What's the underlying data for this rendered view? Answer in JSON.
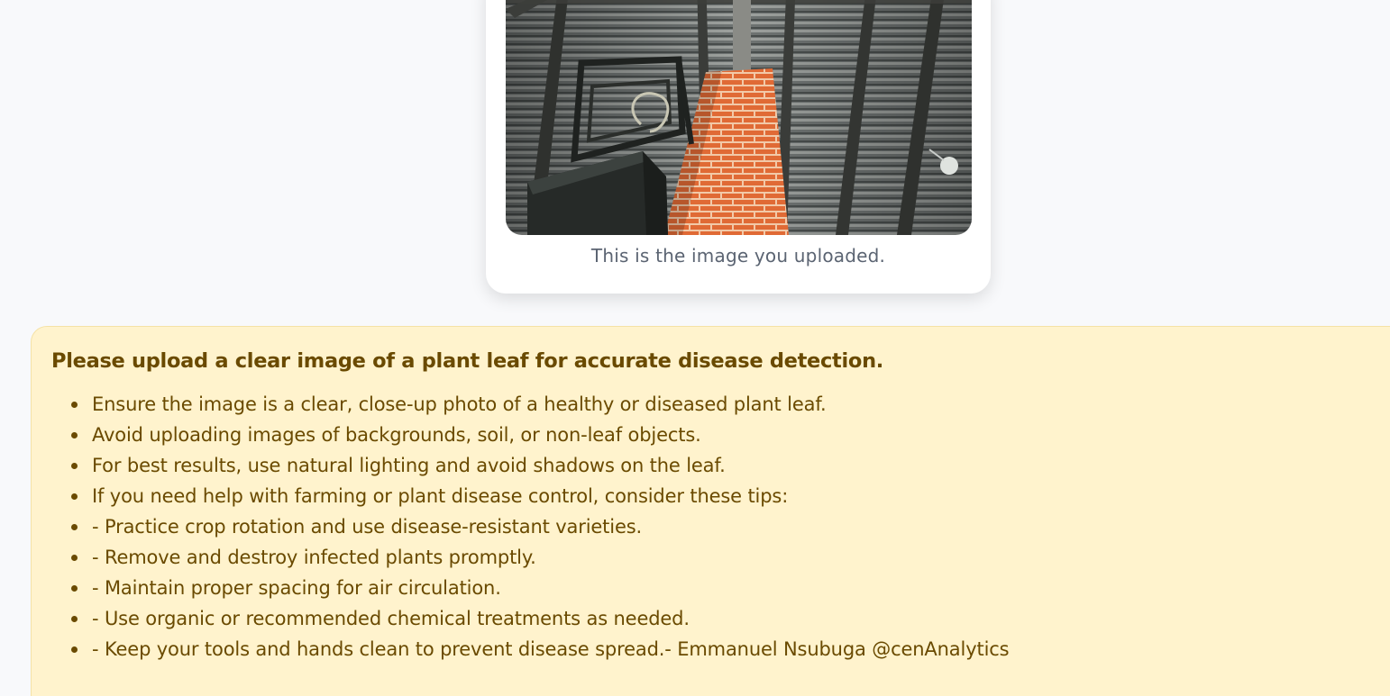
{
  "upload_card": {
    "caption": "This is the image you uploaded."
  },
  "tips": {
    "heading": "Please upload a clear image of a plant leaf for accurate disease detection.",
    "items": [
      "Ensure the image is a clear, close-up photo of a healthy or diseased plant leaf.",
      "Avoid uploading images of backgrounds, soil, or non-leaf objects.",
      "For best results, use natural lighting and avoid shadows on the leaf.",
      "If you need help with farming or plant disease control, consider these tips:",
      "- Practice crop rotation and use disease-resistant varieties.",
      "- Remove and destroy infected plants promptly.",
      "- Maintain proper spacing for air circulation.",
      "- Use organic or recommended chemical treatments as needed.",
      "- Keep your tools and hands clean to prevent disease spread.- Emmanuel Nsubuga @cenAnalytics"
    ]
  },
  "colors": {
    "page_background": "#f8f9fb",
    "card_background": "#ffffff",
    "caption_text": "#5b6472",
    "tips_background": "#fff3cd",
    "tips_text": "#6a4a00"
  }
}
